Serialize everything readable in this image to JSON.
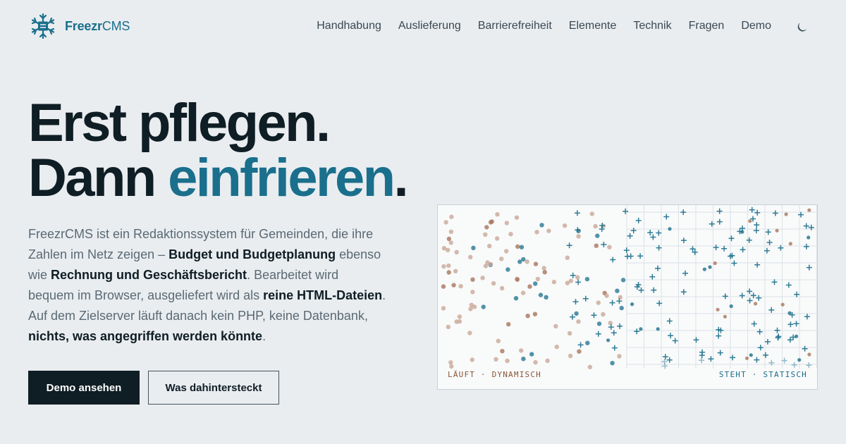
{
  "brand": {
    "name_bold": "Freezr",
    "name_regular": "CMS",
    "icon": "snowflake-logo-icon",
    "color": "#1a6f8c"
  },
  "nav": {
    "items": [
      {
        "label": "Handhabung"
      },
      {
        "label": "Auslieferung"
      },
      {
        "label": "Barrierefreiheit"
      },
      {
        "label": "Elemente"
      },
      {
        "label": "Technik"
      },
      {
        "label": "Fragen"
      },
      {
        "label": "Demo"
      }
    ],
    "theme_toggle_icon": "moon-icon"
  },
  "hero": {
    "line1": "Erst pflegen.",
    "line2_prefix": "Dann ",
    "line2_accent": "einfrieren",
    "line2_suffix": ".",
    "lead": [
      {
        "text": "FreezrCMS ist ein Redaktionssystem für Gemeinden, die ihre Zahlen im Netz zeigen – ",
        "strong": false
      },
      {
        "text": "Budget und Budgetplanung",
        "strong": true
      },
      {
        "text": " ebenso wie ",
        "strong": false
      },
      {
        "text": "Rechnung und Geschäftsbericht",
        "strong": true
      },
      {
        "text": ". Bearbeitet wird bequem im Browser, ausgeliefert wird als ",
        "strong": false
      },
      {
        "text": "reine HTML-Dateien",
        "strong": true
      },
      {
        "text": ". Auf dem Zielserver läuft danach kein PHP, keine Datenbank, ",
        "strong": false
      },
      {
        "text": "nichts, was angegriffen werden könnte",
        "strong": true
      },
      {
        "text": ".",
        "strong": false
      }
    ]
  },
  "actions": {
    "primary_label": "Demo ansehen",
    "secondary_label": "Was dahintersteckt"
  },
  "visual": {
    "left_label": "LÄUFT · DYNAMISCH",
    "right_label": "STEHT · STATISCH",
    "colors": {
      "dynamic": "#c9a898",
      "dynamic_dark": "#a8765c",
      "static": "#1a6f8c",
      "grid": "#dbe3e8"
    }
  }
}
